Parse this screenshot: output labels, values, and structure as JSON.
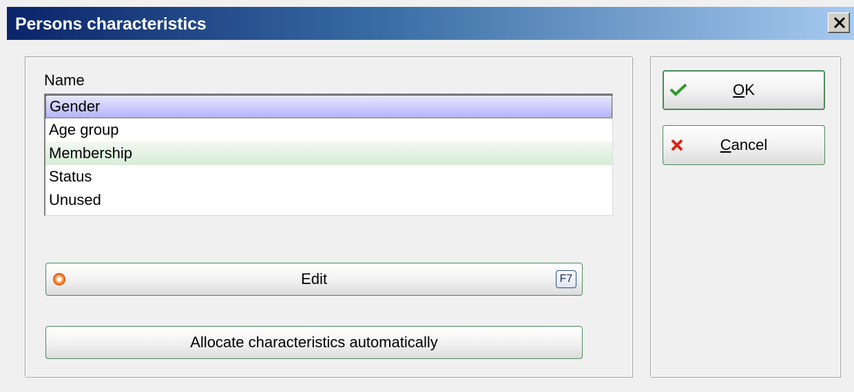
{
  "window": {
    "title": "Persons characteristics",
    "close_icon": "close-icon"
  },
  "list": {
    "label": "Name",
    "items": [
      {
        "label": "Gender",
        "state": "selected"
      },
      {
        "label": "Age group",
        "state": "normal"
      },
      {
        "label": "Membership",
        "state": "highlighted"
      },
      {
        "label": "Status",
        "state": "normal"
      },
      {
        "label": "Unused",
        "state": "normal"
      }
    ]
  },
  "buttons": {
    "edit": {
      "label": "Edit",
      "shortcut": "F7",
      "icon": "circle-icon"
    },
    "allocate": {
      "label": "Allocate characteristics automatically"
    },
    "ok": {
      "mnemonic": "O",
      "rest": "K",
      "icon": "checkmark-icon"
    },
    "cancel": {
      "mnemonic": "C",
      "rest": "ancel",
      "icon": "cross-icon"
    }
  },
  "colors": {
    "title_gradient_start": "#0a246a",
    "title_gradient_end": "#a6caf0",
    "selected_row": "#b4b4f8",
    "highlight_row": "#d6ecd6",
    "button_border": "#4a8a5a"
  }
}
